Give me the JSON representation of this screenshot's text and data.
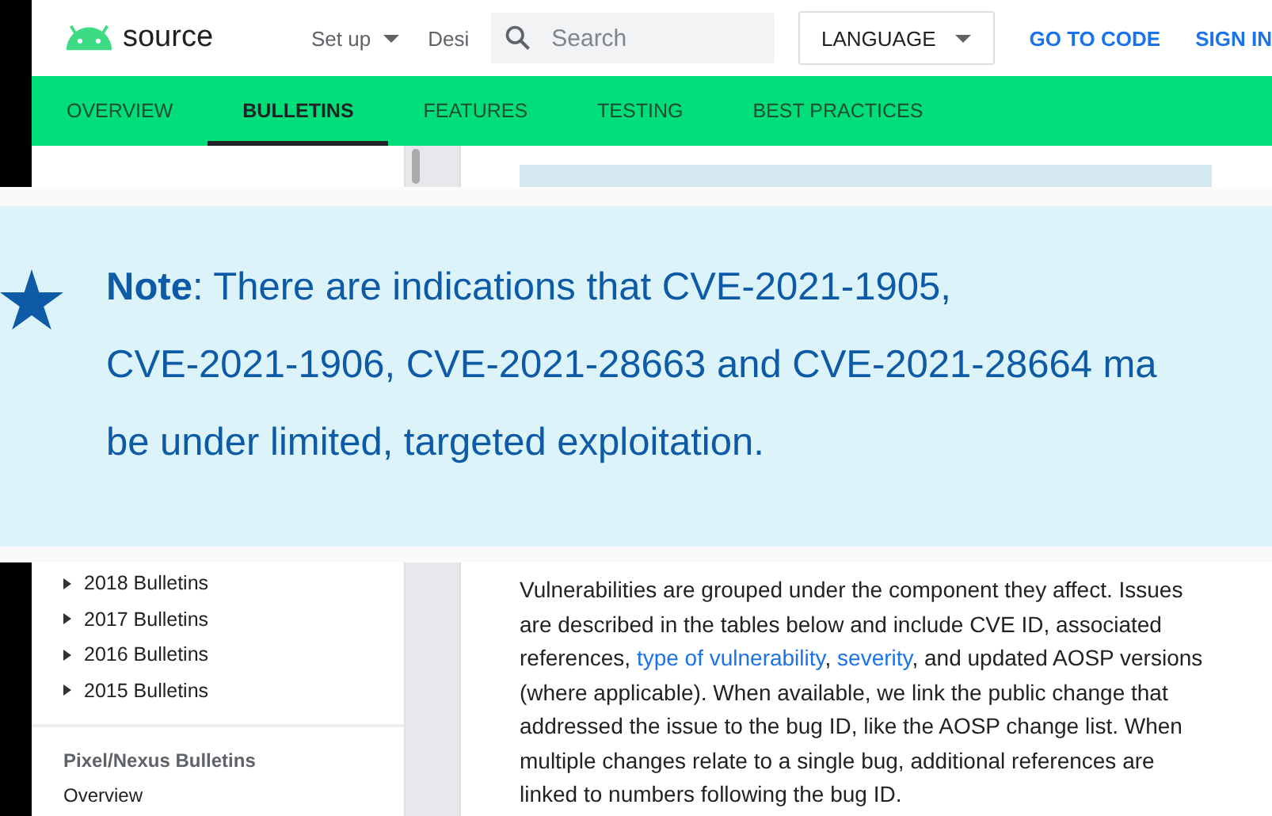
{
  "header": {
    "logo_text": "source",
    "menu": [
      {
        "label": "Set up",
        "has_caret": true
      },
      {
        "label": "Desi",
        "has_caret": false
      }
    ],
    "search": {
      "placeholder": "Search"
    },
    "language_button": "LANGUAGE",
    "links": [
      "GO TO CODE",
      "SIGN IN"
    ]
  },
  "tabs": [
    {
      "label": "OVERVIEW",
      "selected": false
    },
    {
      "label": "BULLETINS",
      "selected": true
    },
    {
      "label": "FEATURES",
      "selected": false
    },
    {
      "label": "TESTING",
      "selected": false
    },
    {
      "label": "BEST PRACTICES",
      "selected": false
    }
  ],
  "callout": {
    "lines": [
      "**Note**: There are indications that CVE-2021-1905,",
      "CVE-2021-1906, CVE-2021-28663 and CVE-2021-28664 ma",
      "be under limited, targeted exploitation."
    ]
  },
  "sidebar": {
    "items": [
      {
        "label": "2018 Bulletins",
        "expanded": false
      },
      {
        "label": "2017 Bulletins",
        "expanded": false
      },
      {
        "label": "2016 Bulletins",
        "expanded": false
      },
      {
        "label": "2015 Bulletins",
        "expanded": false
      }
    ],
    "section_title": "Pixel/Nexus Bulletins",
    "section_items": [
      "Overview"
    ]
  },
  "body": {
    "parts": [
      {
        "kind": "text",
        "text": "Vulnerabilities are grouped under the component they affect. Issues are described in the tables below and include CVE ID, associated references, "
      },
      {
        "kind": "link",
        "text": "type of vulnerability"
      },
      {
        "kind": "text",
        "text": ", "
      },
      {
        "kind": "link",
        "text": "severity"
      },
      {
        "kind": "text",
        "text": ", and updated AOSP versions (where applicable). When available, we link the public change that addressed the issue to the bug ID, like the AOSP change list. When multiple changes relate to a single bug, additional references are linked to numbers following the bug ID."
      }
    ]
  }
}
